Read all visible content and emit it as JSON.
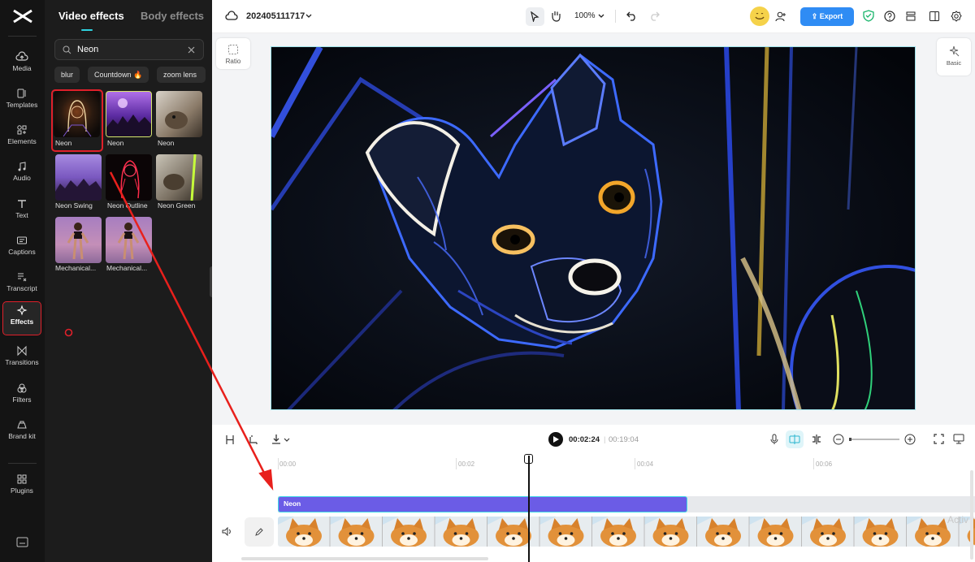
{
  "rail": {
    "items": [
      {
        "label": "Media",
        "icon": "cloud-upload-icon"
      },
      {
        "label": "Templates",
        "icon": "templates-icon"
      },
      {
        "label": "Elements",
        "icon": "elements-icon"
      },
      {
        "label": "Audio",
        "icon": "music-note-icon"
      },
      {
        "label": "Text",
        "icon": "text-icon"
      },
      {
        "label": "Captions",
        "icon": "captions-icon"
      },
      {
        "label": "Transcript",
        "icon": "transcript-icon"
      },
      {
        "label": "Effects",
        "icon": "sparkle-icon"
      },
      {
        "label": "Transitions",
        "icon": "transitions-icon"
      },
      {
        "label": "Filters",
        "icon": "filters-icon"
      },
      {
        "label": "Brand kit",
        "icon": "brand-kit-icon"
      },
      {
        "label": "Plugins",
        "icon": "plugins-icon"
      }
    ],
    "active": "Effects",
    "accent": "#e0202a"
  },
  "panel": {
    "tabs": [
      "Video effects",
      "Body effects"
    ],
    "active_tab": "Video effects",
    "search_value": "Neon",
    "chips": [
      "blur",
      "Countdown 🔥",
      "zoom lens"
    ],
    "effects": [
      {
        "label": "Neon",
        "selected": true
      },
      {
        "label": "Neon"
      },
      {
        "label": "Neon"
      },
      {
        "label": "Neon Swing"
      },
      {
        "label": "Neon Outline"
      },
      {
        "label": "Neon Green"
      },
      {
        "label": "Mechanical..."
      },
      {
        "label": "Mechanical..."
      }
    ]
  },
  "topbar": {
    "project_name": "202405111717",
    "zoom": "100%",
    "export_label": "Export",
    "export_color": "#2f8cf4"
  },
  "stage": {
    "ratio_label": "Ratio",
    "basic_label": "Basic"
  },
  "timeline": {
    "current_time": "00:02:24",
    "total_time": "00:19:04",
    "separator": "|",
    "ruler": [
      "00:00",
      "00:02",
      "00:04",
      "00:06"
    ],
    "effect_clip_label": "Neon",
    "effect_clip_color": "#6b5ce6",
    "watermark": "Activ"
  }
}
